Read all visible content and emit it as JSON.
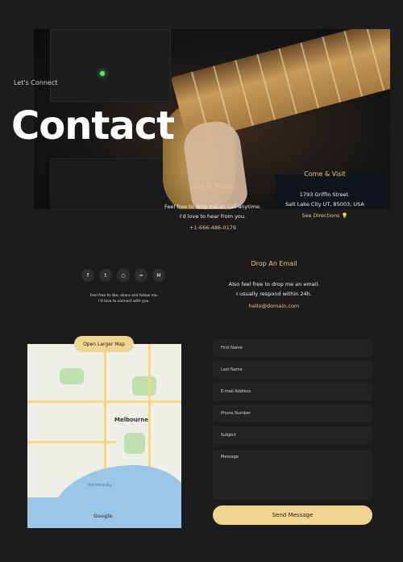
{
  "hero": {
    "eyebrow": "Let's Connect",
    "title": "Contact"
  },
  "touch": {
    "heading": "Get In Touch",
    "line1": "Feel free to drop me an call anytime.",
    "line2": "I'd love to hear from you.",
    "phone": "+1-666-486-0179"
  },
  "visit": {
    "heading": "Come & Visit",
    "line1": "1793 Griffin Street.",
    "line2": "Salt Lake City UT, 85003, USA",
    "link": "See Directions"
  },
  "social": {
    "icons": [
      "facebook-icon",
      "twitter-icon",
      "instagram-icon",
      "spotify-icon",
      "bandcamp-icon"
    ],
    "line1": "Feel free to like, share and follow me.",
    "line2": "I'd love to connect with you."
  },
  "email": {
    "heading": "Drop An Email",
    "line1": "Also feel free to drop me an email.",
    "line2": "I usually respond within 24h.",
    "address": "hello@domain.com"
  },
  "map": {
    "button": "Open Larger Map",
    "city": "Melbourne",
    "bay": "Port Phillip Bay",
    "logo": "Google"
  },
  "form": {
    "first_name": "First Name",
    "last_name": "Last Name",
    "email": "E-mail Address",
    "phone": "Phone Number",
    "subject": "Subject",
    "message": "Message",
    "submit": "Send Message"
  },
  "colors": {
    "background": "#1c1c1c",
    "accent": "#f0d592",
    "field": "#232323"
  }
}
